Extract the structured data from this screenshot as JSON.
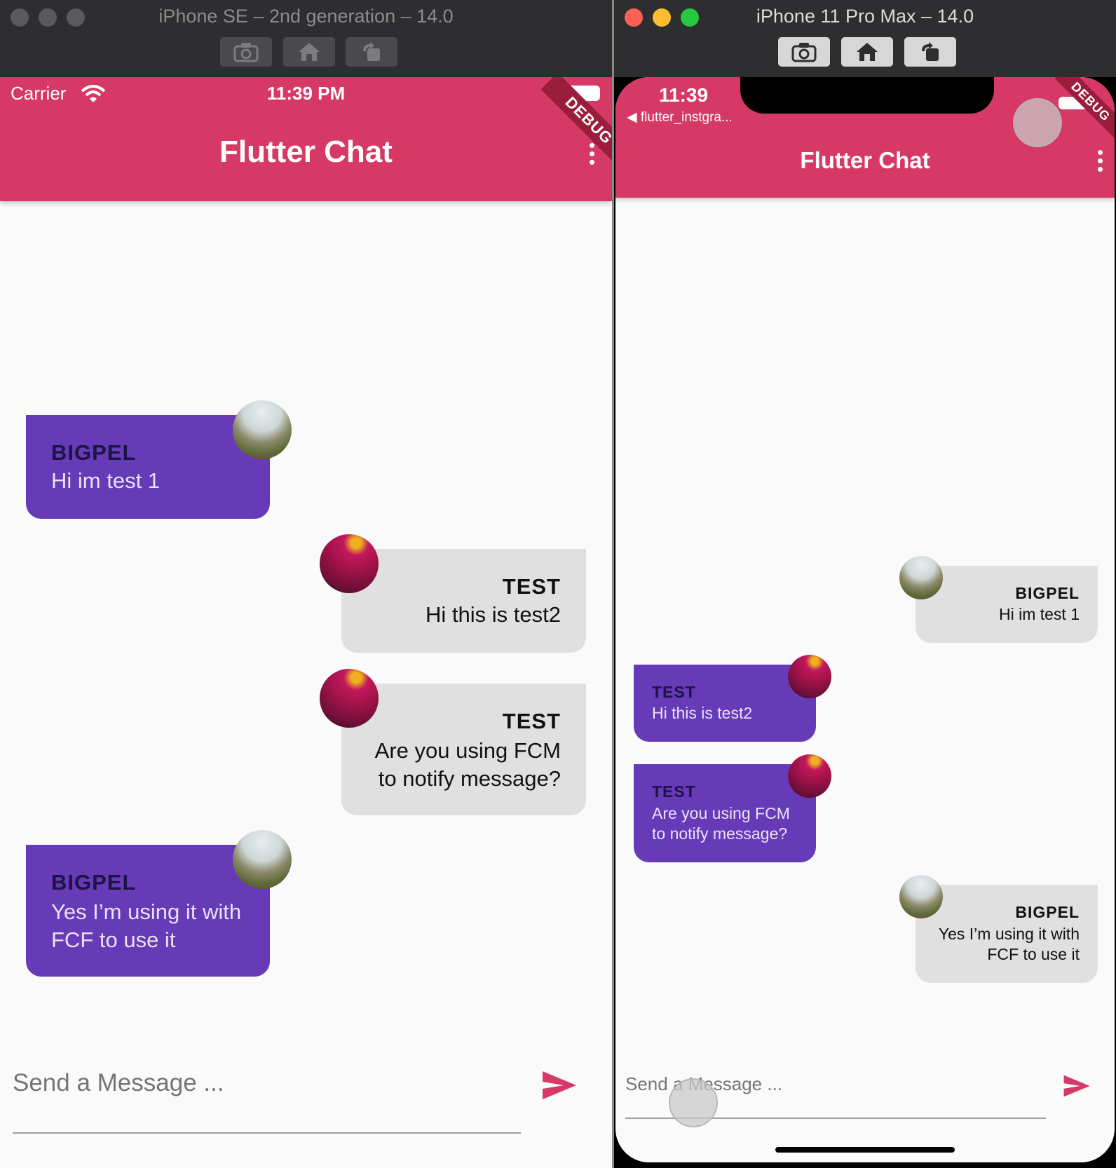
{
  "simulators": [
    {
      "window_title": "iPhone SE – 2nd generation – 14.0",
      "status": {
        "carrier": "Carrier",
        "time": "11:39 PM"
      },
      "appbar": {
        "title": "Flutter Chat",
        "debug_banner": "DEBUG"
      },
      "messages": [
        {
          "sender": "BIGPEL",
          "text": "Hi im test 1",
          "style": "purple",
          "avatar": "landscape-avatar"
        },
        {
          "sender": "TEST",
          "text": "Hi this is test2",
          "style": "grey",
          "avatar": "flower-avatar"
        },
        {
          "sender": "TEST",
          "text": "Are you using FCM\nto notify message?",
          "style": "grey",
          "avatar": "flower-avatar"
        },
        {
          "sender": "BIGPEL",
          "text": "Yes I’m using it with\nFCF to use it",
          "style": "purple",
          "avatar": "landscape-avatar"
        }
      ],
      "composer": {
        "placeholder": "Send a Message ...",
        "send_icon": "send-icon"
      }
    },
    {
      "window_title": "iPhone 11 Pro Max – 14.0",
      "status": {
        "time": "11:39",
        "back_app": "◀ flutter_instgra..."
      },
      "appbar": {
        "title": "Flutter Chat",
        "debug_banner": "DEBUG"
      },
      "messages": [
        {
          "sender": "BIGPEL",
          "text": "Hi im test 1",
          "style": "grey",
          "avatar": "landscape-avatar"
        },
        {
          "sender": "TEST",
          "text": "Hi this is test2",
          "style": "purple",
          "avatar": "flower-avatar"
        },
        {
          "sender": "TEST",
          "text": "Are you using FCM\nto notify message?",
          "style": "purple",
          "avatar": "flower-avatar"
        },
        {
          "sender": "BIGPEL",
          "text": "Yes I’m using it with\nFCF to use it",
          "style": "grey",
          "avatar": "landscape-avatar"
        }
      ],
      "composer": {
        "placeholder": "Send a Message ...",
        "send_icon": "send-icon"
      }
    }
  ],
  "colors": {
    "appbar": "#d63966",
    "purple_bubble": "#673ab7",
    "grey_bubble": "#e0e0e0",
    "send_icon": "#d63966"
  }
}
